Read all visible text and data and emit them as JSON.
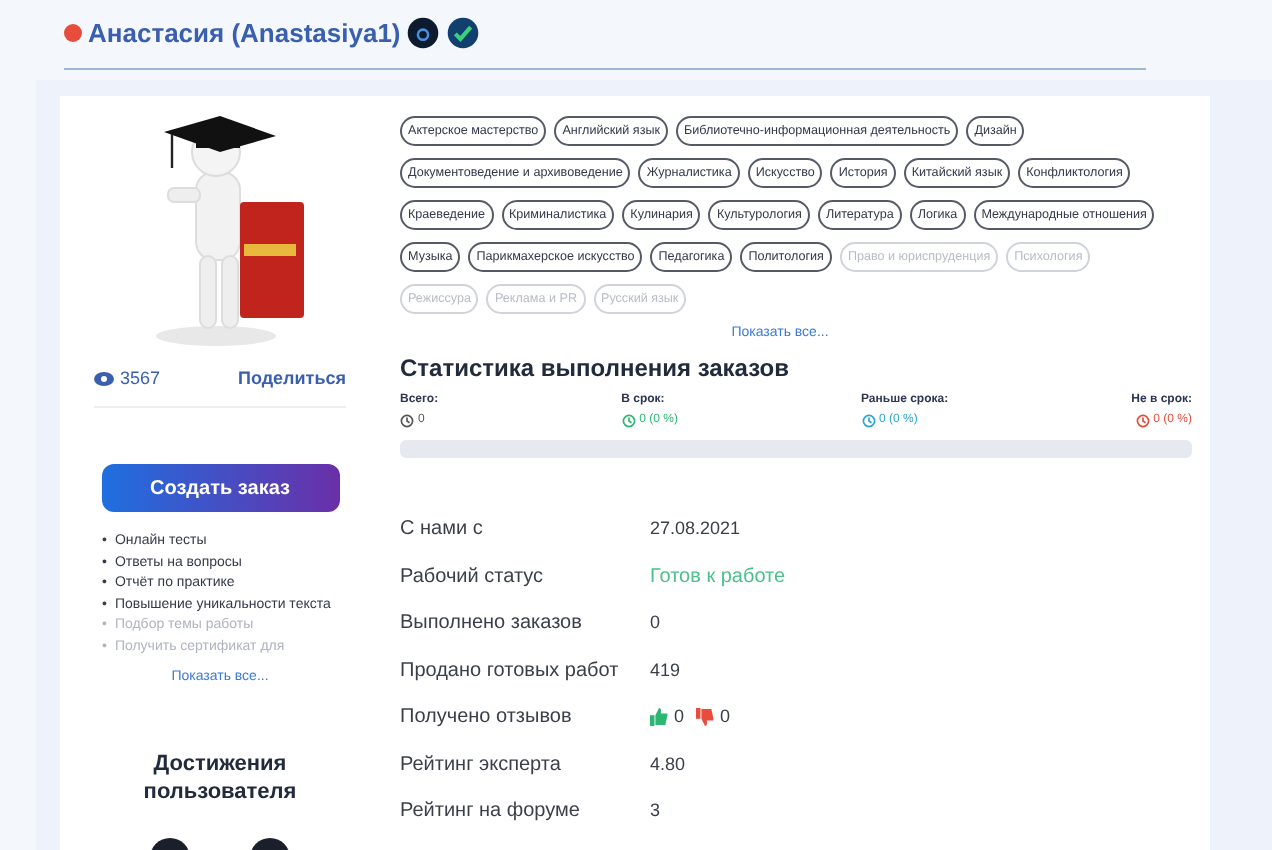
{
  "user": {
    "name": "Анастасия (Anastasiya1)",
    "online": false
  },
  "profile": {
    "views": "3567",
    "share": "Поделиться"
  },
  "create_button": "Создать заказ",
  "services_bullet": "•",
  "services": [
    {
      "label": "Онлайн тесты",
      "faded": false
    },
    {
      "label": "Ответы на вопросы",
      "faded": false
    },
    {
      "label": "Отчёт по практике",
      "faded": false
    },
    {
      "label": "Повышение уникальности текста",
      "faded": false
    },
    {
      "label": "Подбор темы работы",
      "faded": true
    },
    {
      "label": "Получить сертификат для",
      "faded": true
    }
  ],
  "services_more": "Показать все...",
  "achievements_title": "Достижения пользователя",
  "subjects": [
    {
      "label": "Актерское мастерство",
      "faded": false
    },
    {
      "label": "Английский язык",
      "faded": false
    },
    {
      "label": "Библиотечно-информационная деятельность",
      "faded": false
    },
    {
      "label": "Дизайн",
      "faded": false
    },
    {
      "label": "Документоведение и архивоведение",
      "faded": false
    },
    {
      "label": "Журналистика",
      "faded": false
    },
    {
      "label": "Искусство",
      "faded": false
    },
    {
      "label": "История",
      "faded": false
    },
    {
      "label": "Китайский язык",
      "faded": false
    },
    {
      "label": "Конфликтология",
      "faded": false
    },
    {
      "label": "Краеведение",
      "faded": false
    },
    {
      "label": "Криминалистика",
      "faded": false
    },
    {
      "label": "Кулинария",
      "faded": false
    },
    {
      "label": "Культурология",
      "faded": false
    },
    {
      "label": "Литература",
      "faded": false
    },
    {
      "label": "Логика",
      "faded": false
    },
    {
      "label": "Международные отношения",
      "faded": false
    },
    {
      "label": "Музыка",
      "faded": false
    },
    {
      "label": "Парикмахерское искусство",
      "faded": false
    },
    {
      "label": "Педагогика",
      "faded": false
    },
    {
      "label": "Политология",
      "faded": false
    },
    {
      "label": "Право и юриспруденция",
      "faded": true
    },
    {
      "label": "Психология",
      "faded": true
    },
    {
      "label": "Режиссура",
      "faded": true
    },
    {
      "label": "Реклама и PR",
      "faded": true
    },
    {
      "label": "Русский язык",
      "faded": true
    }
  ],
  "subjects_more": "Показать все...",
  "stats": {
    "title": "Статистика выполнения заказов",
    "items": [
      {
        "label": "Всего:",
        "value": "0",
        "color": "#555555"
      },
      {
        "label": "В срок:",
        "value": "0 (0 %)",
        "color": "#2bb673"
      },
      {
        "label": "Раньше срока:",
        "value": "0 (0 %)",
        "color": "#2aa8c9"
      },
      {
        "label": "Не в срок:",
        "value": "0 (0 %)",
        "color": "#e74c3c"
      }
    ]
  },
  "details": [
    {
      "kind": "text",
      "label": "С нами с",
      "value": "27.08.2021"
    },
    {
      "kind": "status",
      "label": "Рабочий статус",
      "value": "Готов к работе"
    },
    {
      "kind": "text",
      "label": "Выполнено заказов",
      "value": "0"
    },
    {
      "kind": "text",
      "label": "Продано готовых работ",
      "value": "419"
    },
    {
      "kind": "reviews",
      "label": "Получено отзывов",
      "positive": "0",
      "negative": "0"
    },
    {
      "kind": "text",
      "label": "Рейтинг эксперта",
      "value": "4.80"
    },
    {
      "kind": "text",
      "label": "Рейтинг на форуме",
      "value": "3"
    }
  ]
}
